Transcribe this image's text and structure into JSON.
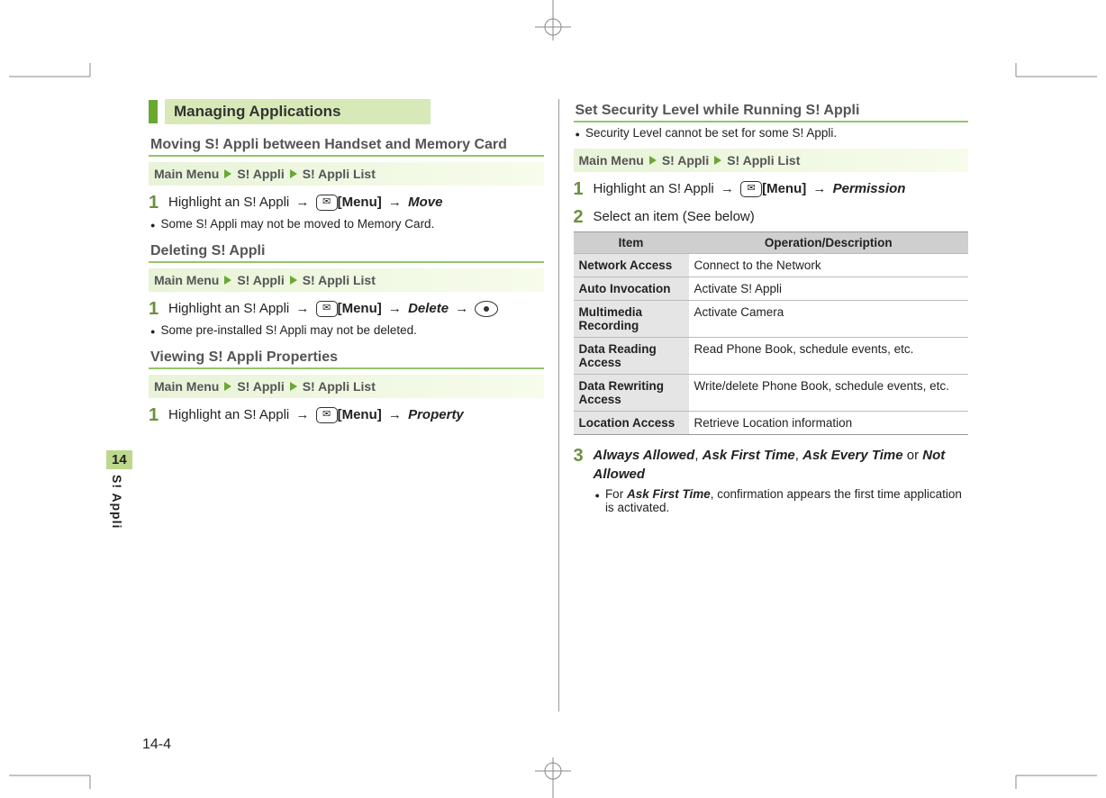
{
  "sideTab": {
    "num": "14",
    "label": "S! Appli"
  },
  "pageNumber": "14-4",
  "left": {
    "heading": "Managing Applications",
    "section1": {
      "title": "Moving S! Appli between Handset and Memory Card",
      "nav": [
        "Main Menu",
        "S! Appli",
        "S! Appli List"
      ],
      "step1_a": "Highlight an S! Appli ",
      "step1_menu": "[Menu]",
      "step1_action": "Move",
      "note": "Some S! Appli may not be moved to Memory Card."
    },
    "section2": {
      "title": "Deleting S! Appli",
      "nav": [
        "Main Menu",
        "S! Appli",
        "S! Appli List"
      ],
      "step1_a": "Highlight an S! Appli ",
      "step1_menu": "[Menu]",
      "step1_action": "Delete",
      "note": "Some pre-installed S! Appli may not be deleted."
    },
    "section3": {
      "title": "Viewing S! Appli Properties",
      "nav": [
        "Main Menu",
        "S! Appli",
        "S! Appli List"
      ],
      "step1_a": "Highlight an S! Appli ",
      "step1_menu": "[Menu]",
      "step1_action": "Property"
    }
  },
  "right": {
    "title": "Set Security Level while Running S! Appli",
    "note_top": "Security Level cannot be set for some S! Appli.",
    "nav": [
      "Main Menu",
      "S! Appli",
      "S! Appli List"
    ],
    "step1_a": "Highlight an S! Appli ",
    "step1_menu": "[Menu]",
    "step1_action": "Permission",
    "step2": "Select an item (See below)",
    "tableHead": {
      "c1": "Item",
      "c2": "Operation/Description"
    },
    "rows": [
      {
        "item": "Network Access",
        "desc": "Connect to the Network"
      },
      {
        "item": "Auto Invocation",
        "desc": "Activate S! Appli"
      },
      {
        "item": "Multimedia Recording",
        "desc": "Activate Camera"
      },
      {
        "item": "Data Reading Access",
        "desc": "Read Phone Book, schedule events, etc."
      },
      {
        "item": "Data Rewriting Access",
        "desc": "Write/delete Phone Book, schedule events, etc."
      },
      {
        "item": "Location Access",
        "desc": "Retrieve Location information"
      }
    ],
    "step3": {
      "opt1": "Always Allowed",
      "sep1": ", ",
      "opt2": "Ask First Time",
      "sep2": ", ",
      "opt3": "Ask Every Time",
      "or": " or ",
      "opt4": "Not Allowed",
      "sub_a": "For ",
      "sub_b": "Ask First Time",
      "sub_c": ", confirmation appears the first time application is activated."
    }
  }
}
